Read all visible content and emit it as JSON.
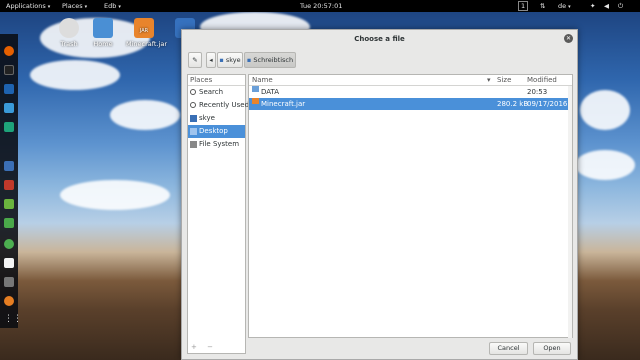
{
  "topbar": {
    "applications": "Applications",
    "places": "Places",
    "app": "Edb",
    "clock": "Tue 20:57:01",
    "workspace": "1",
    "keyboard": "de"
  },
  "desktop": {
    "icons": [
      {
        "label": "Trash",
        "icon": "trash-icon"
      },
      {
        "label": "Home",
        "icon": "home-folder-icon"
      },
      {
        "label": "Minecraft.jar",
        "icon": "jar-file-icon"
      }
    ]
  },
  "dialog": {
    "title": "Choose a file",
    "path": [
      "skye",
      "Schreibtisch"
    ],
    "places_header": "Places",
    "places": [
      {
        "label": "Search",
        "icon": "search-icon"
      },
      {
        "label": "Recently Used",
        "icon": "recent-icon"
      },
      {
        "label": "skye",
        "icon": "home-icon"
      },
      {
        "label": "Desktop",
        "icon": "desktop-icon",
        "selected": true
      },
      {
        "label": "File System",
        "icon": "drive-icon"
      }
    ],
    "places_footer": "+ −",
    "columns": {
      "name": "Name",
      "size": "Size",
      "modified": "Modified"
    },
    "files": [
      {
        "name": "DATA",
        "size": "",
        "modified": "20:53",
        "icon": "folder-icon",
        "selected": false
      },
      {
        "name": "Minecraft.jar",
        "size": "280.2 kB",
        "modified": "09/17/2016",
        "icon": "jar-file-icon",
        "selected": true
      }
    ],
    "cancel_label": "Cancel",
    "open_label": "Open"
  },
  "colors": {
    "selection": "#4a90d9",
    "dialog_bg": "#e8e8e7"
  }
}
